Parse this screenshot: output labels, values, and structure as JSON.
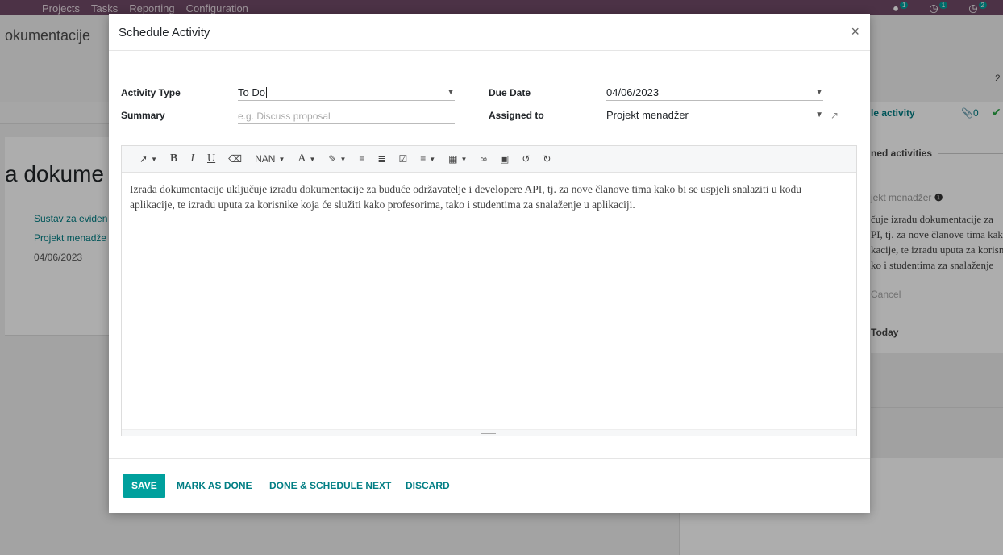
{
  "app": {
    "menu": [
      "Projects",
      "Tasks",
      "Reporting",
      "Configuration"
    ],
    "systray": [
      {
        "icon": "chat-icon",
        "count": "1"
      },
      {
        "icon": "activity-clock-icon",
        "count": "1"
      },
      {
        "icon": "timer-icon",
        "count": "2"
      }
    ]
  },
  "background": {
    "breadcrumb": "okumentacije",
    "title": "a dokume",
    "link1": "Sustav za eviden",
    "link2": "Projekt menadže",
    "date": "04/06/2023",
    "right_number": "2",
    "activity_link": "le activity",
    "attachments_count": "0",
    "planned_header": "ned activities",
    "assignee": "jekt menadžer",
    "note_lines": [
      "čuje izradu dokumentacije za",
      "PI, tj. za nove članove tima kako",
      "kacije, te izradu uputa za korisnike",
      "ko i studentima za snalaženje"
    ],
    "cancel": "Cancel",
    "today": "Today"
  },
  "modal": {
    "title": "Schedule Activity",
    "close": "×",
    "activity_type_label": "Activity Type",
    "activity_type_value": "To Do",
    "summary_label": "Summary",
    "summary_placeholder": "e.g. Discuss proposal",
    "due_date_label": "Due Date",
    "due_date_value": "04/06/2023",
    "assigned_to_label": "Assigned to",
    "assigned_to_value": "Projekt menadžer",
    "toolbar": {
      "font_size": "NAN",
      "bold": "B",
      "italic": "I",
      "underline": "U",
      "font_color": "A"
    },
    "note_text": "Izrada dokumentacije uključuje izradu dokumentacije za  buduće održavatelje i developere API, tj. za nove članove tima kako bi se uspjeli snalaziti u kodu aplikacije, te izradu uputa za korisnike koja će služiti kako profesorima, tako i studentima za snalaženje u aplikaciji.",
    "buttons": {
      "save": "SAVE",
      "mark_done": "MARK AS DONE",
      "done_schedule_next": "DONE & SCHEDULE NEXT",
      "discard": "DISCARD"
    }
  },
  "colors": {
    "brand": "#714B67",
    "accent": "#00A09D",
    "link": "#017e84"
  }
}
